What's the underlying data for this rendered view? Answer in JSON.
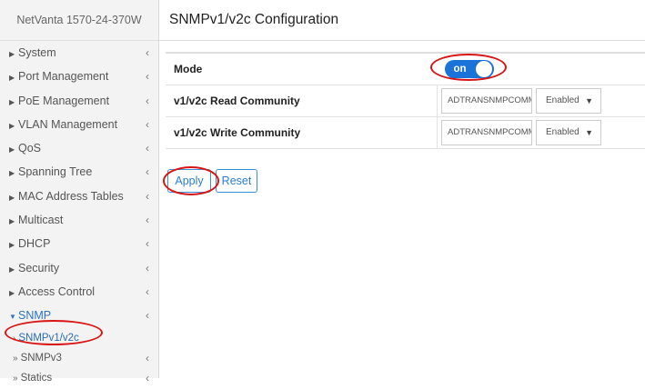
{
  "brand": "NetVanta 1570-24-370W",
  "page_title": "SNMPv1/v2c Configuration",
  "sidebar": {
    "items": [
      {
        "label": "System"
      },
      {
        "label": "Port Management"
      },
      {
        "label": "PoE Management"
      },
      {
        "label": "VLAN Management"
      },
      {
        "label": "QoS"
      },
      {
        "label": "Spanning Tree"
      },
      {
        "label": "MAC Address Tables"
      },
      {
        "label": "Multicast"
      },
      {
        "label": "DHCP"
      },
      {
        "label": "Security"
      },
      {
        "label": "Access Control"
      },
      {
        "label": "SNMP"
      }
    ],
    "subitems": [
      {
        "label": "SNMPv1/v2c"
      },
      {
        "label": "SNMPv3"
      },
      {
        "label": "Statics"
      }
    ]
  },
  "form": {
    "mode_label": "Mode",
    "mode_value": "on",
    "read_label": "v1/v2c Read Community",
    "read_value": "ADTRANSNMPCOMM",
    "read_state": "Enabled",
    "write_label": "v1/v2c Write Community",
    "write_value": "ADTRANSNMPCOMM",
    "write_state": "Enabled"
  },
  "buttons": {
    "apply": "Apply",
    "reset": "Reset"
  },
  "colors": {
    "accent": "#1a73d9",
    "annotation": "#d81414"
  }
}
